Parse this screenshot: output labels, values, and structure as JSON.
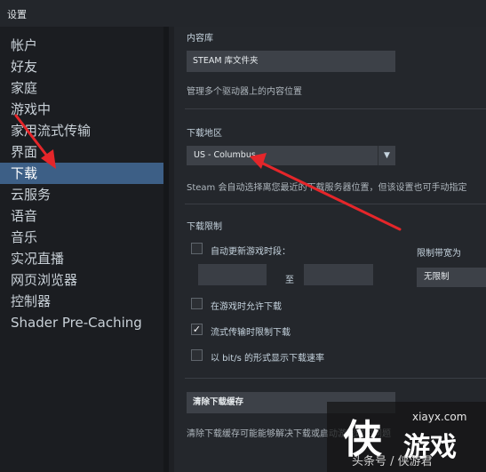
{
  "window": {
    "title": "设置"
  },
  "sidebar": {
    "items": [
      {
        "label": "帐户"
      },
      {
        "label": "好友"
      },
      {
        "label": "家庭"
      },
      {
        "label": "游戏中"
      },
      {
        "label": "家用流式传输"
      },
      {
        "label": "界面"
      },
      {
        "label": "下载",
        "active": true
      },
      {
        "label": "云服务"
      },
      {
        "label": "语音"
      },
      {
        "label": "音乐"
      },
      {
        "label": "实况直播"
      },
      {
        "label": "网页浏览器"
      },
      {
        "label": "控制器"
      },
      {
        "label": "Shader Pre-Caching"
      }
    ]
  },
  "content_library": {
    "header": "内容库",
    "button": "STEAM 库文件夹",
    "description": "管理多个驱动器上的内容位置"
  },
  "download_region": {
    "header": "下载地区",
    "selected": "US - Columbus",
    "description": "Steam 会自动选择离您最近的下载服务器位置，但该设置也可手动指定"
  },
  "download_limits": {
    "header": "下载限制",
    "auto_update_label": "自动更新游戏时段：",
    "to_label": "至",
    "bandwidth_label": "限制带宽为",
    "bandwidth_value": "无限制",
    "allow_in_game_label": "在游戏时允许下载",
    "allow_in_game_checked": false,
    "throttle_streaming_label": "流式传输时限制下载",
    "throttle_streaming_checked": true,
    "show_bits_label": "以 bit/s 的形式显示下载速率",
    "show_bits_checked": false,
    "auto_update_checked": false
  },
  "cache": {
    "button": "清除下载缓存",
    "description": "清除下载缓存可能能够解决下载或启动游戏时的问题"
  },
  "watermark": {
    "site": "xiayx.com",
    "logo_char": "侠",
    "logo_text": "游戏",
    "byline": "头条号 / 侠游君"
  },
  "colors": {
    "accent": "#3d5f86",
    "annotation": "#e5262a"
  }
}
